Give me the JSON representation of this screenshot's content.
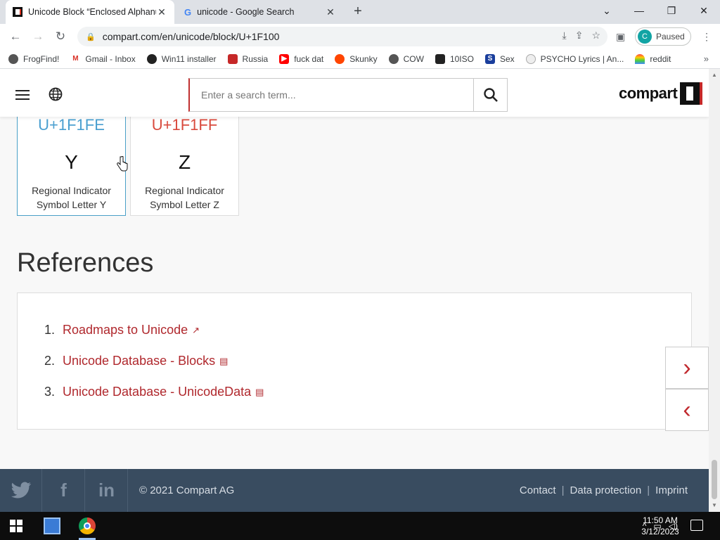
{
  "browser": {
    "tabs": [
      {
        "title": "Unicode Block “Enclosed Alphanumeric Supplement”",
        "active": true
      },
      {
        "title": "unicode - Google Search",
        "active": false
      }
    ],
    "url": "compart.com/en/unicode/block/U+1F100",
    "profile_label": "Paused",
    "profile_initial": "C",
    "bookmarks": [
      {
        "label": "FrogFind!",
        "icon": "globe-icon"
      },
      {
        "label": "Gmail - Inbox",
        "icon": "gmail-icon"
      },
      {
        "label": "Win11 installer",
        "icon": "github-icon"
      },
      {
        "label": "Russia",
        "icon": "bookmark-red-icon"
      },
      {
        "label": "fuck dat",
        "icon": "youtube-icon"
      },
      {
        "label": "Skunky",
        "icon": "reddit-icon"
      },
      {
        "label": "COW",
        "icon": "globe-icon"
      },
      {
        "label": "10ISO",
        "icon": "building-icon"
      },
      {
        "label": "Sex",
        "icon": "s-icon"
      },
      {
        "label": "PSYCHO Lyrics | An...",
        "icon": "circle-icon"
      },
      {
        "label": "reddit",
        "icon": "rainbow-icon"
      }
    ]
  },
  "site": {
    "search_placeholder": "Enter a search term...",
    "logo_text": "compart"
  },
  "cards": [
    {
      "code": "U+1F1FE",
      "glyph": "Y",
      "name_line1": "Regional Indicator",
      "name_line2": "Symbol Letter Y",
      "code_color": "#4a9fd0"
    },
    {
      "code": "U+1F1FF",
      "glyph": "Z",
      "name_line1": "Regional Indicator",
      "name_line2": "Symbol Letter Z",
      "code_color": "#d94a3d"
    }
  ],
  "references": {
    "title": "References",
    "items": [
      {
        "num": "1.",
        "label": "Roadmaps to Unicode",
        "icon": "external-link-icon"
      },
      {
        "num": "2.",
        "label": "Unicode Database - Blocks",
        "icon": "document-icon"
      },
      {
        "num": "3.",
        "label": "Unicode Database - UnicodeData",
        "icon": "document-icon"
      }
    ]
  },
  "footer": {
    "copyright": "© 2021 Compart AG",
    "links": [
      "Contact",
      "Data protection",
      "Imprint"
    ]
  },
  "taskbar": {
    "time": "11:50 AM",
    "date": "3/12/2023"
  },
  "colors": {
    "link_red": "#b0282d",
    "footer_bg": "#394c60",
    "selected_border": "#4aa0c8"
  }
}
